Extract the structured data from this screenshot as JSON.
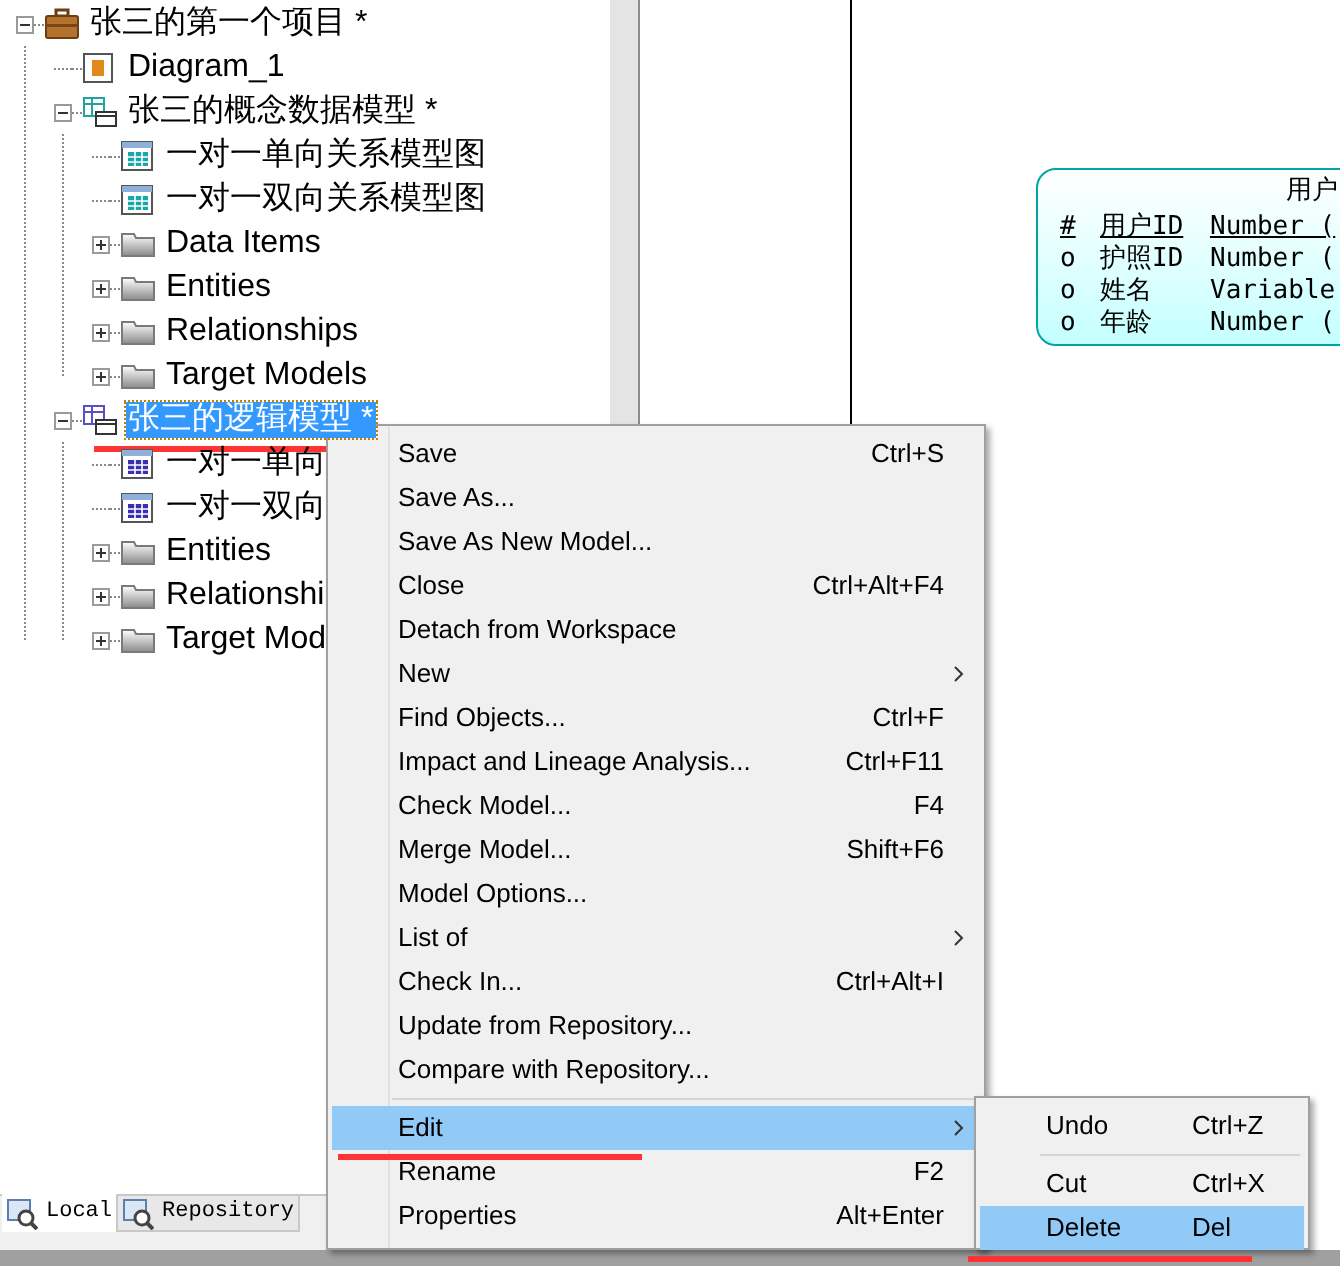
{
  "tree": [
    {
      "label": "张三的第一个项目 *",
      "kind": "project",
      "expanded": true,
      "selected": false,
      "red_underline": false,
      "children": [
        {
          "label": "Diagram_1",
          "kind": "diagram",
          "selected": false,
          "red_underline": false
        },
        {
          "label": "张三的概念数据模型 *",
          "kind": "conceptual-model",
          "expanded": true,
          "selected": false,
          "red_underline": false,
          "children": [
            {
              "label": "一对一单向关系模型图",
              "kind": "conceptual-diagram",
              "selected": false,
              "red_underline": false
            },
            {
              "label": "一对一双向关系模型图",
              "kind": "conceptual-diagram",
              "selected": false,
              "red_underline": false
            },
            {
              "label": "Data Items",
              "kind": "folder",
              "expanded": false,
              "selected": false,
              "red_underline": false
            },
            {
              "label": "Entities",
              "kind": "folder",
              "expanded": false,
              "selected": false,
              "red_underline": false
            },
            {
              "label": "Relationships",
              "kind": "folder",
              "expanded": false,
              "selected": false,
              "red_underline": false
            },
            {
              "label": "Target Models",
              "kind": "folder",
              "expanded": false,
              "selected": false,
              "red_underline": false
            }
          ]
        },
        {
          "label": "张三的逻辑模型 *",
          "kind": "logical-model",
          "expanded": true,
          "selected": true,
          "red_underline": true,
          "children": [
            {
              "label": "一对一单向",
              "kind": "logical-diagram",
              "selected": false,
              "red_underline": false
            },
            {
              "label": "一对一双向",
              "kind": "logical-diagram",
              "selected": false,
              "red_underline": false
            },
            {
              "label": "Entities",
              "kind": "folder",
              "expanded": false,
              "selected": false,
              "red_underline": false
            },
            {
              "label": "Relationshi",
              "kind": "folder",
              "expanded": false,
              "selected": false,
              "red_underline": false
            },
            {
              "label": "Target Mod",
              "kind": "folder",
              "expanded": false,
              "selected": false,
              "red_underline": false
            }
          ]
        }
      ]
    }
  ],
  "bottom_tabs": [
    {
      "label": "Local",
      "selected": true
    },
    {
      "label": "Repository",
      "selected": false
    }
  ],
  "entity": {
    "title": "用户",
    "attributes": [
      {
        "marker": "#",
        "name": "用户ID",
        "type": "Number (",
        "identifier": true
      },
      {
        "marker": "o",
        "name": "护照ID",
        "type": "Number (",
        "identifier": false
      },
      {
        "marker": "o",
        "name": "姓名",
        "type": "Variable",
        "identifier": false
      },
      {
        "marker": "o",
        "name": "年龄",
        "type": "Number (",
        "identifier": false
      }
    ]
  },
  "context_menu": [
    {
      "kind": "item",
      "label": "Save",
      "shortcut": "Ctrl+S",
      "submenu": false,
      "selected": false,
      "red_underline": false
    },
    {
      "kind": "item",
      "label": "Save As...",
      "submenu": false,
      "selected": false,
      "red_underline": false
    },
    {
      "kind": "item",
      "label": "Save As New Model...",
      "submenu": false,
      "selected": false,
      "red_underline": false
    },
    {
      "kind": "item",
      "label": "Close",
      "shortcut": "Ctrl+Alt+F4",
      "submenu": false,
      "selected": false,
      "red_underline": false
    },
    {
      "kind": "item",
      "label": "Detach from Workspace",
      "submenu": false,
      "selected": false,
      "red_underline": false
    },
    {
      "kind": "item",
      "label": "New",
      "submenu": true,
      "selected": false,
      "red_underline": false
    },
    {
      "kind": "item",
      "label": "Find Objects...",
      "shortcut": "Ctrl+F",
      "submenu": false,
      "selected": false,
      "red_underline": false
    },
    {
      "kind": "item",
      "label": "Impact and Lineage Analysis...",
      "shortcut": "Ctrl+F11",
      "submenu": false,
      "selected": false,
      "red_underline": false
    },
    {
      "kind": "item",
      "label": "Check Model...",
      "shortcut": "F4",
      "submenu": false,
      "selected": false,
      "red_underline": false
    },
    {
      "kind": "item",
      "label": "Merge Model...",
      "shortcut": "Shift+F6",
      "submenu": false,
      "selected": false,
      "red_underline": false
    },
    {
      "kind": "item",
      "label": "Model Options...",
      "submenu": false,
      "selected": false,
      "red_underline": false
    },
    {
      "kind": "item",
      "label": "List of",
      "submenu": true,
      "selected": false,
      "red_underline": false
    },
    {
      "kind": "item",
      "label": "Check In...",
      "shortcut": "Ctrl+Alt+I",
      "submenu": false,
      "selected": false,
      "red_underline": false
    },
    {
      "kind": "item",
      "label": "Update from Repository...",
      "submenu": false,
      "selected": false,
      "red_underline": false
    },
    {
      "kind": "item",
      "label": "Compare with Repository...",
      "submenu": false,
      "selected": false,
      "red_underline": false
    },
    {
      "kind": "separator"
    },
    {
      "kind": "item",
      "label": "Edit",
      "submenu": true,
      "selected": true,
      "red_underline": true
    },
    {
      "kind": "item",
      "label": "Rename",
      "shortcut": "F2",
      "submenu": false,
      "selected": false,
      "red_underline": false
    },
    {
      "kind": "item",
      "label": "Properties",
      "shortcut": "Alt+Enter",
      "submenu": false,
      "selected": false,
      "red_underline": false
    }
  ],
  "edit_submenu": [
    {
      "kind": "item",
      "label": "Undo",
      "shortcut": "Ctrl+Z",
      "selected": false,
      "red_underline": false
    },
    {
      "kind": "separator"
    },
    {
      "kind": "item",
      "label": "Cut",
      "shortcut": "Ctrl+X",
      "selected": false,
      "red_underline": false
    },
    {
      "kind": "item",
      "label": "Delete",
      "shortcut": "Del",
      "selected": true,
      "red_underline": true
    }
  ]
}
